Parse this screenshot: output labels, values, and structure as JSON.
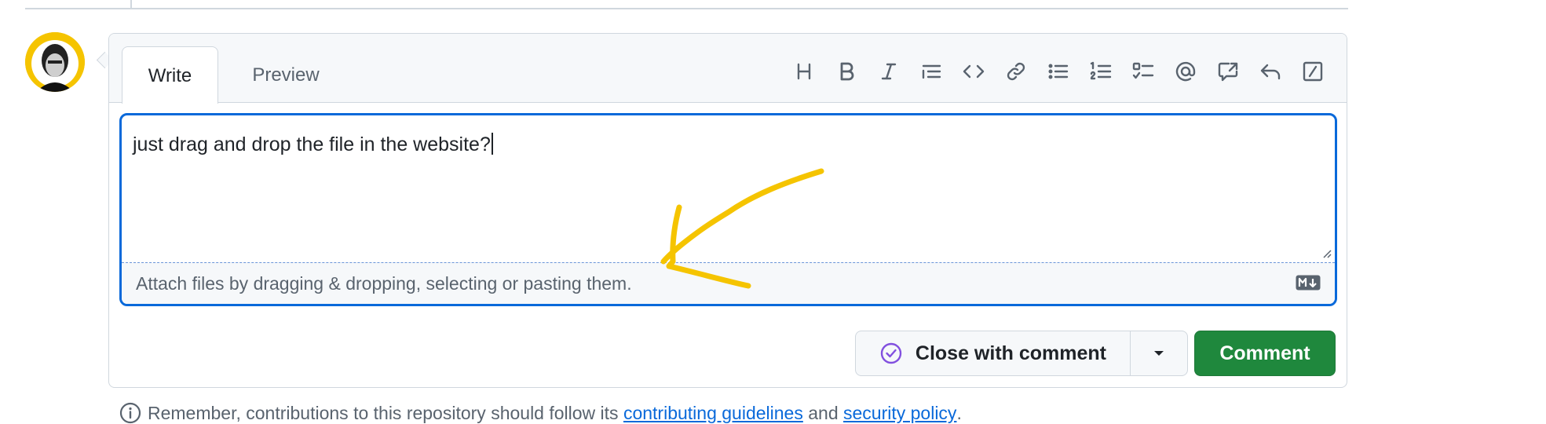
{
  "tabs": [
    {
      "label": "Write",
      "active": true
    },
    {
      "label": "Preview",
      "active": false
    }
  ],
  "toolbar": [
    {
      "icon": "heading-icon"
    },
    {
      "icon": "bold-icon"
    },
    {
      "icon": "italic-icon"
    },
    {
      "icon": "quote-icon"
    },
    {
      "icon": "code-icon"
    },
    {
      "icon": "link-icon"
    },
    {
      "icon": "unordered-list-icon"
    },
    {
      "icon": "ordered-list-icon"
    },
    {
      "icon": "task-list-icon"
    },
    {
      "icon": "mention-icon"
    },
    {
      "icon": "cross-reference-icon"
    },
    {
      "icon": "reply-icon"
    },
    {
      "icon": "slash-commands-icon"
    }
  ],
  "editor": {
    "value": "just drag and drop the file in the website?",
    "attach_hint": "Attach files by dragging & dropping, selecting or pasting them.",
    "markdown_icon": "markdown-icon"
  },
  "actions": {
    "close_label": "Close with comment",
    "comment_label": "Comment"
  },
  "footer": {
    "prefix": "Remember, contributions to this repository should follow its",
    "link1": "contributing guidelines",
    "and": "and",
    "link2": "security policy",
    "suffix": "."
  },
  "colors": {
    "accent": "#0969da",
    "comment_button": "#1f883d",
    "annotation": "#f5c400",
    "close_icon": "#8250df"
  }
}
